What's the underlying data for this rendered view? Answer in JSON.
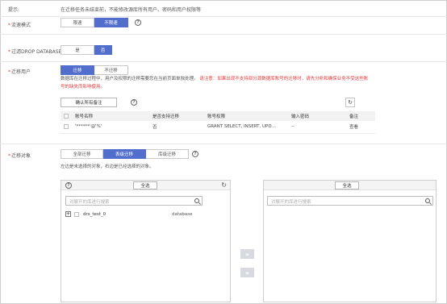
{
  "hint": {
    "label": "提示:",
    "text": "在迁移任务未结束前，不能修改源库所有用户、密码和用户权限等"
  },
  "flow_mode": {
    "label": "流速模式",
    "options": [
      "限速",
      "不限速"
    ],
    "selected": "不限速"
  },
  "drop_database": {
    "label": "过滤DROP DATABASE",
    "options": [
      "是",
      "否"
    ],
    "selected": "否"
  },
  "migrate_users": {
    "label": "迁移用户",
    "options": [
      "迁移",
      "不迁移"
    ],
    "selected": "迁移",
    "note": "数据库在迁移过程中，用户及权限的迁移需要您在当前页面单独处理。",
    "warning_line1": "请注意：如果出现不支持部分源数据库账号的迁移时，请先分析和确保业务不受这些账",
    "warning_line2": "号的缺失而影响使用。",
    "confirm_button": "确认所有备注",
    "table": {
      "headers": [
        "",
        "账号名称",
        "是否支持迁移",
        "账号权限",
        "输入密码",
        "备注"
      ],
      "rows": [
        {
          "account": "'******'@'%'",
          "supported": "否",
          "privileges": "GRANT SELECT, INSERT, UPD...",
          "password": "--",
          "remark": "查看"
        }
      ]
    }
  },
  "migrate_objects": {
    "label": "迁移对象",
    "options": [
      "全部迁移",
      "表级迁移",
      "库级迁移"
    ],
    "selected": "表级迁移",
    "note": "左边是未选择的对象，右边是已经选择的对象。",
    "left_panel": {
      "select_all": "全选",
      "search_placeholder": "对展开的库进行搜索",
      "items": [
        {
          "name": "drs_test_0",
          "type": "database"
        }
      ]
    },
    "right_panel": {
      "select_all": "全选",
      "search_placeholder": "对展开的库进行搜索"
    },
    "move_right_symbol": "»",
    "move_left_symbol": "«"
  },
  "colors": {
    "accent": "#526ecc",
    "required": "#e4393c"
  },
  "icons": {
    "help": "help-icon",
    "refresh": "refresh-icon",
    "search": "search-icon",
    "expand": "plus-icon"
  }
}
